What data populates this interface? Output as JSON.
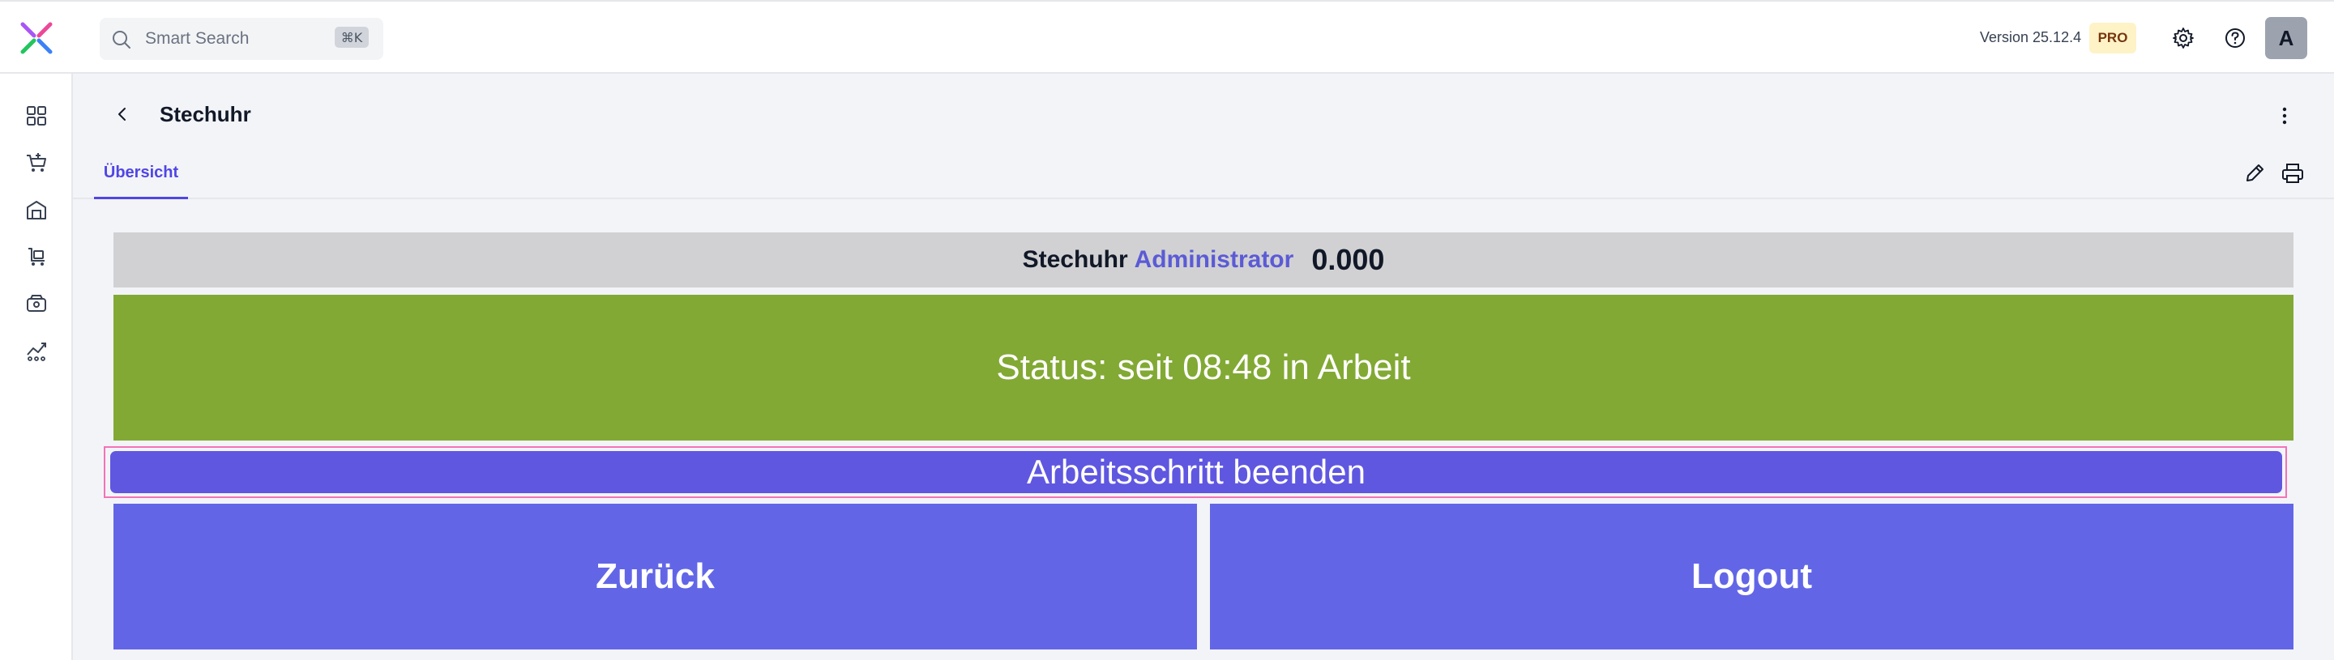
{
  "header": {
    "search": {
      "placeholder": "Smart Search",
      "shortcut": "⌘K"
    },
    "version": "Version 25.12.4",
    "plan_badge": "PRO",
    "avatar_initial": "A",
    "icons": [
      "settings-icon",
      "help-icon"
    ]
  },
  "sidebar": {
    "items": [
      {
        "icon": "dashboard-icon"
      },
      {
        "icon": "cart-icon"
      },
      {
        "icon": "warehouse-icon"
      },
      {
        "icon": "shopping-trolley-icon"
      },
      {
        "icon": "register-icon"
      },
      {
        "icon": "analytics-icon"
      }
    ]
  },
  "page": {
    "title": "Stechuhr",
    "tabs": [
      {
        "label": "Übersicht",
        "active": true
      }
    ]
  },
  "clock": {
    "label": "Stechuhr",
    "user": "Administrator",
    "value": "0.000",
    "status": "Status: seit 08:48 in Arbeit",
    "end_step": "Arbeitsschritt beenden",
    "back": "Zurück",
    "logout": "Logout"
  },
  "colors": {
    "accent": "#4f46e5",
    "status_green": "#82a934",
    "button_blue": "#6266e6",
    "step_button": "#5f57e0",
    "info_bar": "#d1d1d3"
  }
}
